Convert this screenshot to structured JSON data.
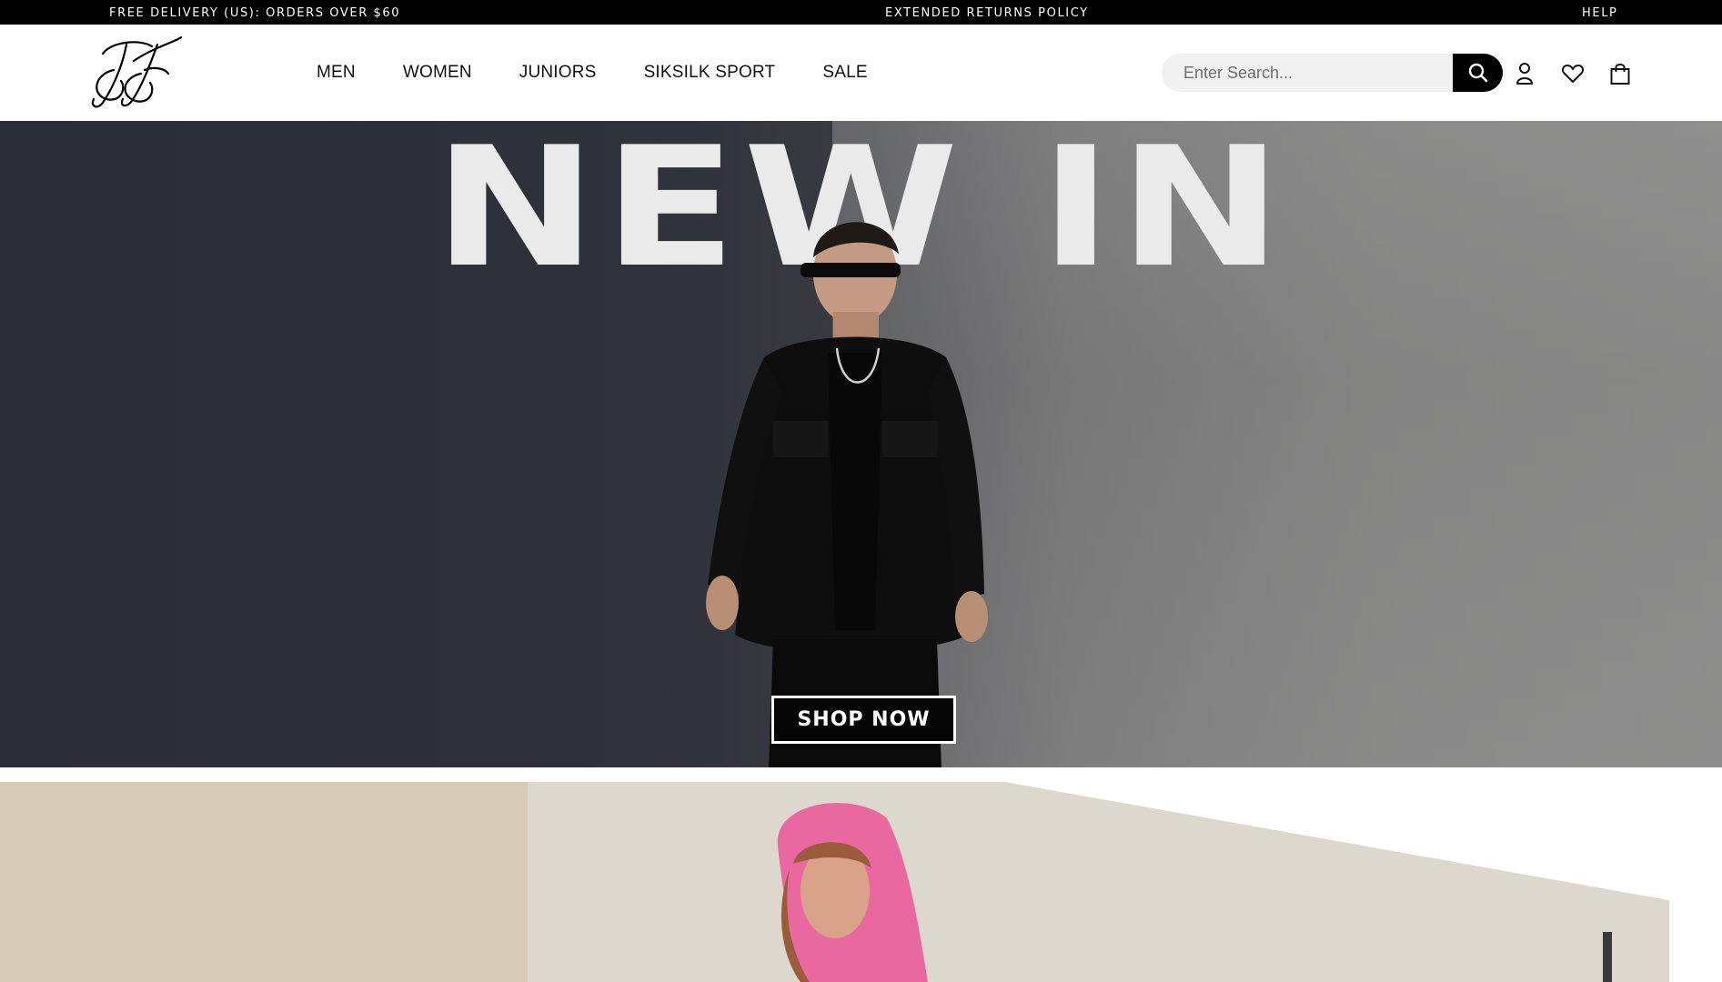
{
  "announcement": {
    "left": "FREE DELIVERY (US): ORDERS OVER $60",
    "center": "EXTENDED RETURNS POLICY",
    "right": "HELP"
  },
  "header": {
    "nav": [
      "MEN",
      "WOMEN",
      "JUNIORS",
      "SIKSILK SPORT",
      "SALE"
    ],
    "search_placeholder": "Enter Search...",
    "icons": [
      "search-icon",
      "account-icon",
      "wishlist-icon",
      "bag-icon"
    ]
  },
  "hero": {
    "title": "NEW IN",
    "cta": "SHOP NOW"
  },
  "colors": {
    "topbar": "#000000",
    "accent_pink": "#e8689f"
  }
}
